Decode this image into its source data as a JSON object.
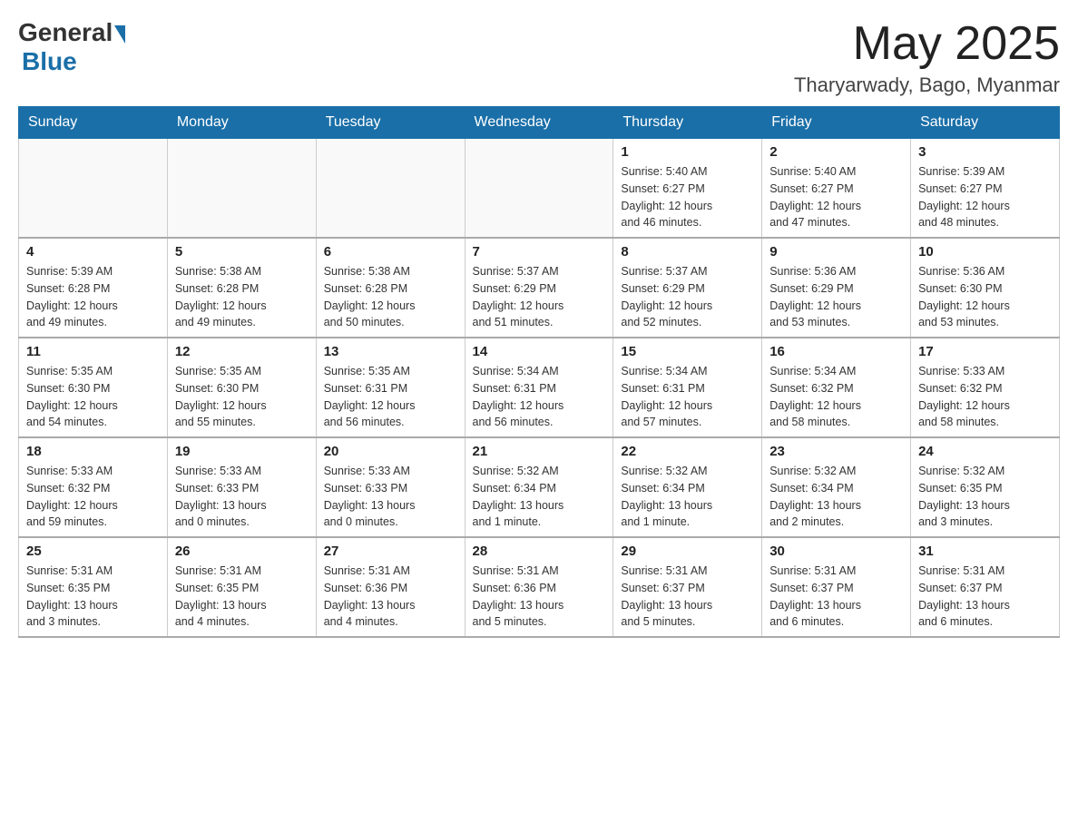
{
  "header": {
    "logo_general": "General",
    "logo_blue": "Blue",
    "month_year": "May 2025",
    "location": "Tharyarwady, Bago, Myanmar"
  },
  "weekdays": [
    "Sunday",
    "Monday",
    "Tuesday",
    "Wednesday",
    "Thursday",
    "Friday",
    "Saturday"
  ],
  "weeks": [
    [
      {
        "day": "",
        "info": ""
      },
      {
        "day": "",
        "info": ""
      },
      {
        "day": "",
        "info": ""
      },
      {
        "day": "",
        "info": ""
      },
      {
        "day": "1",
        "info": "Sunrise: 5:40 AM\nSunset: 6:27 PM\nDaylight: 12 hours\nand 46 minutes."
      },
      {
        "day": "2",
        "info": "Sunrise: 5:40 AM\nSunset: 6:27 PM\nDaylight: 12 hours\nand 47 minutes."
      },
      {
        "day": "3",
        "info": "Sunrise: 5:39 AM\nSunset: 6:27 PM\nDaylight: 12 hours\nand 48 minutes."
      }
    ],
    [
      {
        "day": "4",
        "info": "Sunrise: 5:39 AM\nSunset: 6:28 PM\nDaylight: 12 hours\nand 49 minutes."
      },
      {
        "day": "5",
        "info": "Sunrise: 5:38 AM\nSunset: 6:28 PM\nDaylight: 12 hours\nand 49 minutes."
      },
      {
        "day": "6",
        "info": "Sunrise: 5:38 AM\nSunset: 6:28 PM\nDaylight: 12 hours\nand 50 minutes."
      },
      {
        "day": "7",
        "info": "Sunrise: 5:37 AM\nSunset: 6:29 PM\nDaylight: 12 hours\nand 51 minutes."
      },
      {
        "day": "8",
        "info": "Sunrise: 5:37 AM\nSunset: 6:29 PM\nDaylight: 12 hours\nand 52 minutes."
      },
      {
        "day": "9",
        "info": "Sunrise: 5:36 AM\nSunset: 6:29 PM\nDaylight: 12 hours\nand 53 minutes."
      },
      {
        "day": "10",
        "info": "Sunrise: 5:36 AM\nSunset: 6:30 PM\nDaylight: 12 hours\nand 53 minutes."
      }
    ],
    [
      {
        "day": "11",
        "info": "Sunrise: 5:35 AM\nSunset: 6:30 PM\nDaylight: 12 hours\nand 54 minutes."
      },
      {
        "day": "12",
        "info": "Sunrise: 5:35 AM\nSunset: 6:30 PM\nDaylight: 12 hours\nand 55 minutes."
      },
      {
        "day": "13",
        "info": "Sunrise: 5:35 AM\nSunset: 6:31 PM\nDaylight: 12 hours\nand 56 minutes."
      },
      {
        "day": "14",
        "info": "Sunrise: 5:34 AM\nSunset: 6:31 PM\nDaylight: 12 hours\nand 56 minutes."
      },
      {
        "day": "15",
        "info": "Sunrise: 5:34 AM\nSunset: 6:31 PM\nDaylight: 12 hours\nand 57 minutes."
      },
      {
        "day": "16",
        "info": "Sunrise: 5:34 AM\nSunset: 6:32 PM\nDaylight: 12 hours\nand 58 minutes."
      },
      {
        "day": "17",
        "info": "Sunrise: 5:33 AM\nSunset: 6:32 PM\nDaylight: 12 hours\nand 58 minutes."
      }
    ],
    [
      {
        "day": "18",
        "info": "Sunrise: 5:33 AM\nSunset: 6:32 PM\nDaylight: 12 hours\nand 59 minutes."
      },
      {
        "day": "19",
        "info": "Sunrise: 5:33 AM\nSunset: 6:33 PM\nDaylight: 13 hours\nand 0 minutes."
      },
      {
        "day": "20",
        "info": "Sunrise: 5:33 AM\nSunset: 6:33 PM\nDaylight: 13 hours\nand 0 minutes."
      },
      {
        "day": "21",
        "info": "Sunrise: 5:32 AM\nSunset: 6:34 PM\nDaylight: 13 hours\nand 1 minute."
      },
      {
        "day": "22",
        "info": "Sunrise: 5:32 AM\nSunset: 6:34 PM\nDaylight: 13 hours\nand 1 minute."
      },
      {
        "day": "23",
        "info": "Sunrise: 5:32 AM\nSunset: 6:34 PM\nDaylight: 13 hours\nand 2 minutes."
      },
      {
        "day": "24",
        "info": "Sunrise: 5:32 AM\nSunset: 6:35 PM\nDaylight: 13 hours\nand 3 minutes."
      }
    ],
    [
      {
        "day": "25",
        "info": "Sunrise: 5:31 AM\nSunset: 6:35 PM\nDaylight: 13 hours\nand 3 minutes."
      },
      {
        "day": "26",
        "info": "Sunrise: 5:31 AM\nSunset: 6:35 PM\nDaylight: 13 hours\nand 4 minutes."
      },
      {
        "day": "27",
        "info": "Sunrise: 5:31 AM\nSunset: 6:36 PM\nDaylight: 13 hours\nand 4 minutes."
      },
      {
        "day": "28",
        "info": "Sunrise: 5:31 AM\nSunset: 6:36 PM\nDaylight: 13 hours\nand 5 minutes."
      },
      {
        "day": "29",
        "info": "Sunrise: 5:31 AM\nSunset: 6:37 PM\nDaylight: 13 hours\nand 5 minutes."
      },
      {
        "day": "30",
        "info": "Sunrise: 5:31 AM\nSunset: 6:37 PM\nDaylight: 13 hours\nand 6 minutes."
      },
      {
        "day": "31",
        "info": "Sunrise: 5:31 AM\nSunset: 6:37 PM\nDaylight: 13 hours\nand 6 minutes."
      }
    ]
  ]
}
